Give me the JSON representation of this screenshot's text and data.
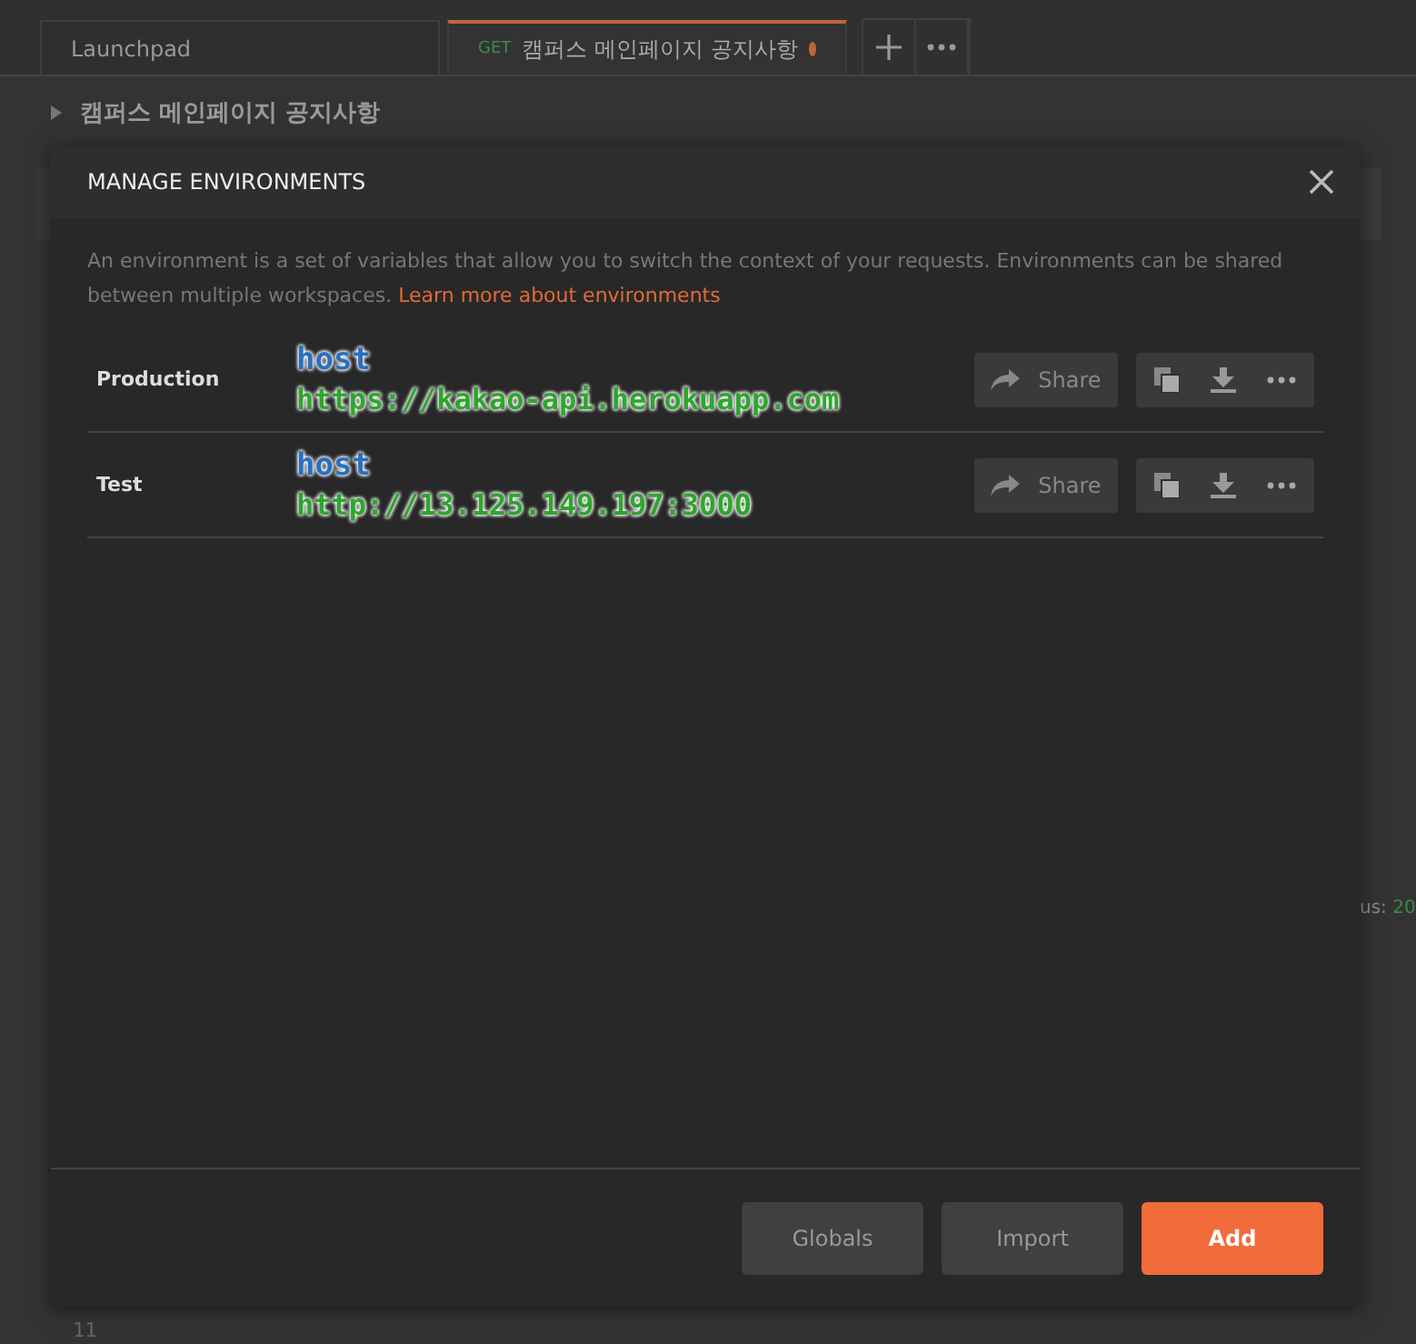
{
  "tabs": [
    {
      "label": "Launchpad",
      "selected": false,
      "unsaved": false
    },
    {
      "label": "캠퍼스 메인페이지 공지사항",
      "method": "GET",
      "selected": true,
      "unsaved": true
    }
  ],
  "request_title": "캠퍼스 메인페이지 공지사항",
  "background": {
    "status_label": "us:",
    "status_value": "20",
    "line_numbers": [
      "11"
    ]
  },
  "modal": {
    "title": "MANAGE ENVIRONMENTS",
    "description": "An environment is a set of variables that allow you to switch the context of your requests. Environments can be shared between multiple workspaces.",
    "link": "Learn more about environments",
    "environments": [
      {
        "name": "Production",
        "note_key": "host",
        "note_value": "https://kakao-api.herokuapp.com",
        "share": "Share"
      },
      {
        "name": "Test",
        "note_key": "host",
        "note_value": "http://13.125.149.197:3000",
        "share": "Share"
      }
    ],
    "buttons": [
      {
        "label": "Globals",
        "kind": "secondary"
      },
      {
        "label": "Import",
        "kind": "secondary"
      },
      {
        "label": "Add",
        "kind": "primary"
      }
    ]
  }
}
